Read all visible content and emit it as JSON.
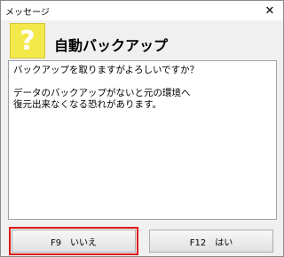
{
  "window": {
    "title": "メッセージ",
    "close_glyph": "✕"
  },
  "header": {
    "icon_text": "?",
    "heading": "自動バックアップ"
  },
  "message": {
    "line1": "バックアップを取りますがよろしいですか？",
    "line2": "データのバックアップがないと元の環境へ",
    "line3": "復元出来なくなる恐れがあります。"
  },
  "buttons": {
    "no_label": "F9　いいえ",
    "yes_label": "F12　はい"
  },
  "colors": {
    "icon_bg": "#f4e94a",
    "highlight": "#e0181b"
  }
}
